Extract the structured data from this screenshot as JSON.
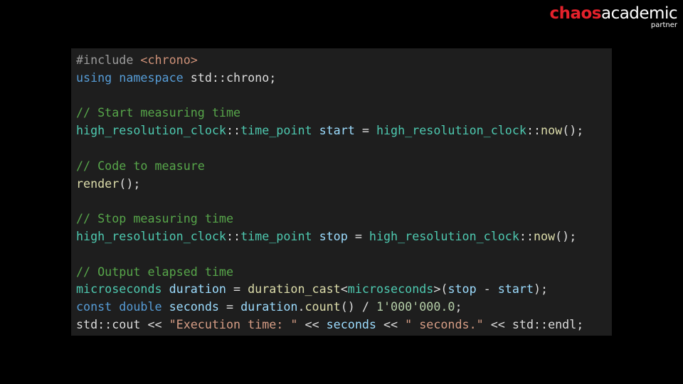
{
  "logo": {
    "brand": "chaos",
    "word": "academic",
    "sub": "partner"
  },
  "code_lines": [
    [
      {
        "t": "#include ",
        "c": "pre"
      },
      {
        "t": "<chrono>",
        "c": "inc"
      }
    ],
    [
      {
        "t": "using ",
        "c": "kw"
      },
      {
        "t": "namespace ",
        "c": "kw"
      },
      {
        "t": "std::chrono;",
        "c": "def"
      }
    ],
    [],
    [
      {
        "t": "// Start measuring time",
        "c": "cmt"
      }
    ],
    [
      {
        "t": "high_resolution_clock",
        "c": "type"
      },
      {
        "t": "::",
        "c": "def"
      },
      {
        "t": "time_point",
        "c": "type"
      },
      {
        "t": " ",
        "c": "def"
      },
      {
        "t": "start",
        "c": "var"
      },
      {
        "t": " = ",
        "c": "def"
      },
      {
        "t": "high_resolution_clock",
        "c": "type"
      },
      {
        "t": "::",
        "c": "def"
      },
      {
        "t": "now",
        "c": "fn"
      },
      {
        "t": "();",
        "c": "def"
      }
    ],
    [],
    [
      {
        "t": "// Code to measure",
        "c": "cmt"
      }
    ],
    [
      {
        "t": "render",
        "c": "fn"
      },
      {
        "t": "();",
        "c": "def"
      }
    ],
    [],
    [
      {
        "t": "// Stop measuring time",
        "c": "cmt"
      }
    ],
    [
      {
        "t": "high_resolution_clock",
        "c": "type"
      },
      {
        "t": "::",
        "c": "def"
      },
      {
        "t": "time_point",
        "c": "type"
      },
      {
        "t": " ",
        "c": "def"
      },
      {
        "t": "stop",
        "c": "var"
      },
      {
        "t": " = ",
        "c": "def"
      },
      {
        "t": "high_resolution_clock",
        "c": "type"
      },
      {
        "t": "::",
        "c": "def"
      },
      {
        "t": "now",
        "c": "fn"
      },
      {
        "t": "();",
        "c": "def"
      }
    ],
    [],
    [
      {
        "t": "// Output elapsed time",
        "c": "cmt"
      }
    ],
    [
      {
        "t": "microseconds",
        "c": "type"
      },
      {
        "t": " ",
        "c": "def"
      },
      {
        "t": "duration",
        "c": "var"
      },
      {
        "t": " = ",
        "c": "def"
      },
      {
        "t": "duration_cast",
        "c": "fn"
      },
      {
        "t": "<",
        "c": "def"
      },
      {
        "t": "microseconds",
        "c": "type"
      },
      {
        "t": ">(",
        "c": "def"
      },
      {
        "t": "stop",
        "c": "var"
      },
      {
        "t": " - ",
        "c": "def"
      },
      {
        "t": "start",
        "c": "var"
      },
      {
        "t": ");",
        "c": "def"
      }
    ],
    [
      {
        "t": "const ",
        "c": "kw"
      },
      {
        "t": "double ",
        "c": "kw"
      },
      {
        "t": "seconds",
        "c": "var"
      },
      {
        "t": " = ",
        "c": "def"
      },
      {
        "t": "duration",
        "c": "var"
      },
      {
        "t": ".",
        "c": "def"
      },
      {
        "t": "count",
        "c": "fn"
      },
      {
        "t": "() / ",
        "c": "def"
      },
      {
        "t": "1'000'000.0",
        "c": "num"
      },
      {
        "t": ";",
        "c": "def"
      }
    ],
    [
      {
        "t": "std::cout << ",
        "c": "def"
      },
      {
        "t": "\"Execution time: \"",
        "c": "str"
      },
      {
        "t": " << ",
        "c": "def"
      },
      {
        "t": "seconds",
        "c": "var"
      },
      {
        "t": " << ",
        "c": "def"
      },
      {
        "t": "\" seconds.\"",
        "c": "str"
      },
      {
        "t": " << std::endl;",
        "c": "def"
      }
    ]
  ]
}
